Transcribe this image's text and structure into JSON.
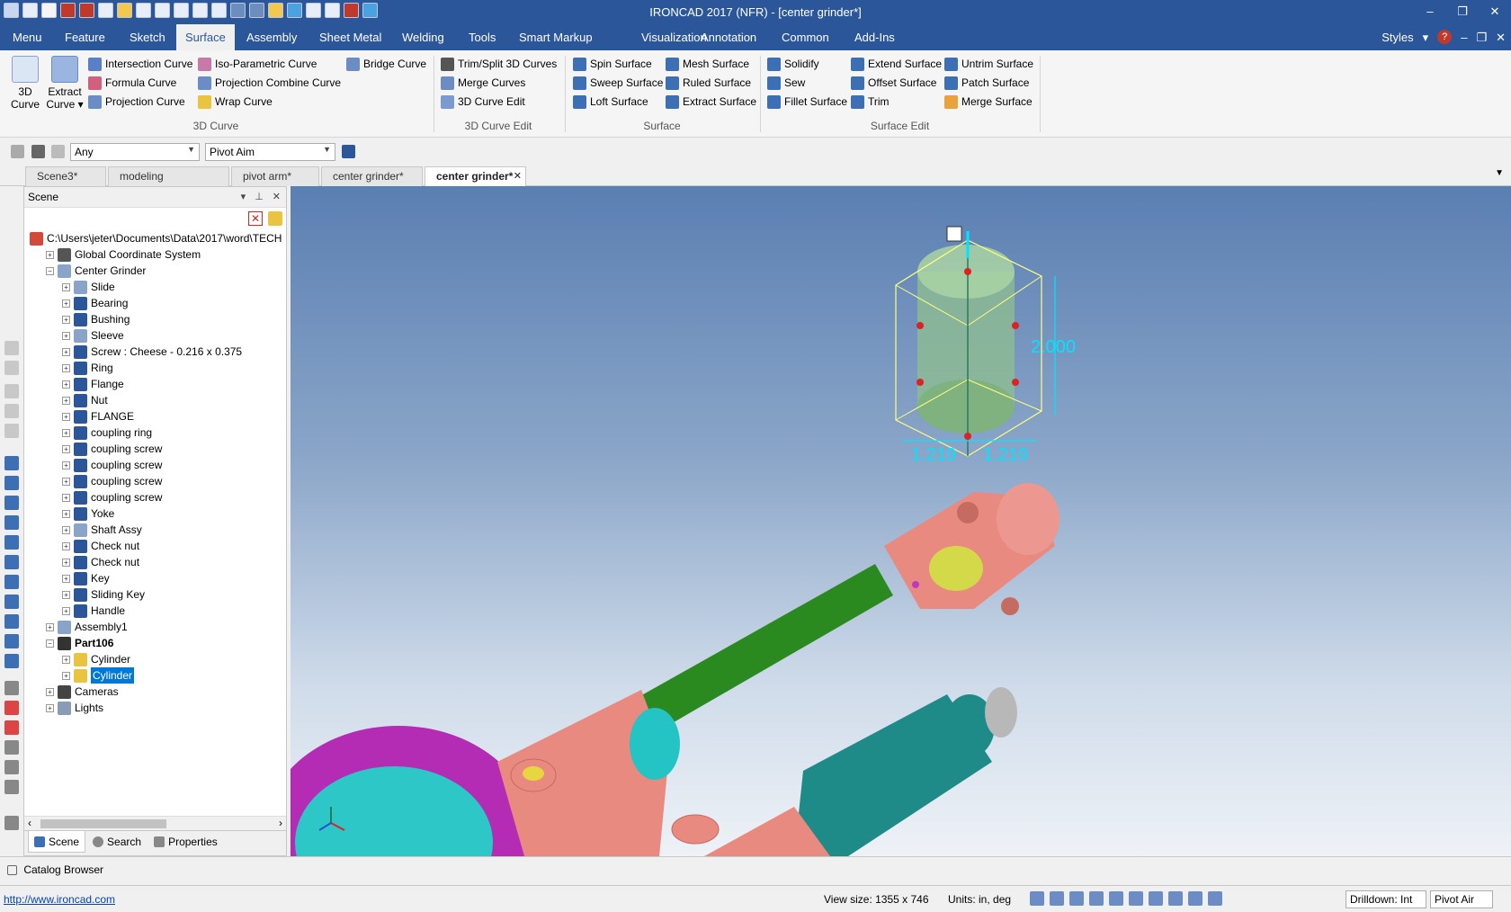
{
  "window": {
    "title": "IRONCAD 2017 (NFR) - [center grinder*]",
    "minimize": "–",
    "maximize": "❐",
    "close": "✕"
  },
  "menu_tabs": [
    "Menu",
    "Feature",
    "Sketch",
    "Surface",
    "Assembly",
    "Sheet Metal",
    "Welding",
    "Tools",
    "Smart Markup",
    "Visualization",
    "Annotation",
    "Common",
    "Add-Ins"
  ],
  "menu_right": {
    "styles": "Styles",
    "styles_arrow": "▾",
    "help": "?",
    "mdi_min": "–",
    "mdi_max": "❐",
    "mdi_close": "✕"
  },
  "ribbon": {
    "curve3d": {
      "line1": "3D",
      "line2": "Curve"
    },
    "extract_curve": {
      "line1": "Extract",
      "line2": "Curve ▾"
    },
    "curves": [
      "Intersection Curve",
      "Formula Curve",
      "Projection Curve",
      "Iso-Parametric Curve",
      "Projection Combine Curve",
      "Wrap Curve",
      "Bridge Curve"
    ],
    "curve_edit": [
      "Trim/Split 3D Curves",
      "Merge Curves",
      "3D Curve Edit"
    ],
    "surface": [
      "Spin Surface",
      "Sweep Surface",
      "Loft Surface",
      "Mesh Surface",
      "Ruled Surface",
      "Extract Surface"
    ],
    "surface_edit": [
      "Solidify",
      "Sew",
      "Fillet Surface",
      "Extend Surface",
      "Offset Surface",
      "Trim",
      "Untrim Surface",
      "Patch Surface",
      "Merge Surface"
    ],
    "groups": [
      "3D Curve",
      "3D Curve Edit",
      "Surface",
      "Surface Edit"
    ]
  },
  "toolbar2": {
    "filter": "Any",
    "pivot": "Pivot Aim"
  },
  "doc_tabs": [
    "Scene3*",
    "modeling techniques",
    "pivot arm*",
    "center grinder*",
    "center grinder*"
  ],
  "doc_tab_close": "✕",
  "scene_panel": {
    "title": "Scene",
    "header_buttons": {
      "dropdown": "▾",
      "pin": "⊥",
      "close": "✕"
    },
    "root": "C:\\Users\\jeter\\Documents\\Data\\2017\\word\\TECH",
    "items": [
      {
        "label": "Global Coordinate System",
        "level": 1
      },
      {
        "label": "Center Grinder",
        "level": 1
      },
      {
        "label": "Slide",
        "level": 2
      },
      {
        "label": "Bearing",
        "level": 2
      },
      {
        "label": "Bushing",
        "level": 2
      },
      {
        "label": "Sleeve",
        "level": 2
      },
      {
        "label": "Screw : Cheese - 0.216 x 0.375",
        "level": 2
      },
      {
        "label": "Ring",
        "level": 2
      },
      {
        "label": "Flange",
        "level": 2
      },
      {
        "label": "Nut",
        "level": 2
      },
      {
        "label": "FLANGE",
        "level": 2
      },
      {
        "label": "coupling ring",
        "level": 2
      },
      {
        "label": "coupling screw",
        "level": 2
      },
      {
        "label": "coupling screw",
        "level": 2
      },
      {
        "label": "coupling screw",
        "level": 2
      },
      {
        "label": "coupling screw",
        "level": 2
      },
      {
        "label": "Yoke",
        "level": 2
      },
      {
        "label": "Shaft Assy",
        "level": 2
      },
      {
        "label": "Check nut",
        "level": 2
      },
      {
        "label": "Check nut",
        "level": 2
      },
      {
        "label": "Key",
        "level": 2
      },
      {
        "label": "Sliding Key",
        "level": 2
      },
      {
        "label": "Handle",
        "level": 2
      },
      {
        "label": "Assembly1",
        "level": 1
      },
      {
        "label": "Part106",
        "level": 1
      },
      {
        "label": "Cylinder",
        "level": 2
      },
      {
        "label": "Cylinder",
        "level": 2
      },
      {
        "label": "Cameras",
        "level": 1
      },
      {
        "label": "Lights",
        "level": 1
      }
    ],
    "scroll_left": "‹",
    "scroll_right": "›",
    "tabs": [
      "Scene",
      "Search",
      "Properties"
    ]
  },
  "viewport": {
    "dim_height": "2.000",
    "dim_w1": "1.219",
    "dim_w2": "1.219"
  },
  "catalog_browser": "Catalog Browser",
  "status": {
    "url": "http://www.ironcad.com",
    "view_size": "View size: 1355 x  746",
    "units": "Units: in, deg",
    "drilldown": "Drilldown: Int",
    "pivot": "Pivot Air"
  },
  "colors": {
    "accent": "#2b579a",
    "selection": "#0078d7"
  }
}
